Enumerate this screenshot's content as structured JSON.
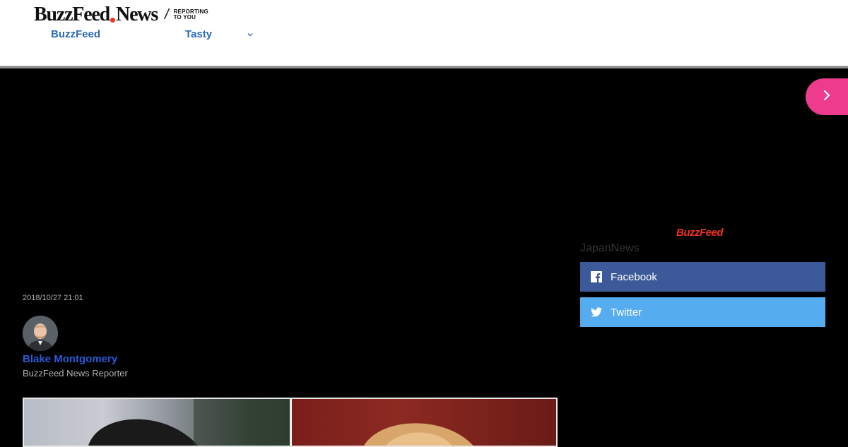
{
  "header": {
    "logo_buzz": "BuzzFeed",
    "logo_news": "News",
    "logo_slash": "/",
    "logo_tagline": "REPORTING TO YOU",
    "nav": [
      {
        "label": "BuzzFeed"
      },
      {
        "label": "Tasty"
      }
    ]
  },
  "sidebar": {
    "brand": "BuzzFeed",
    "section": "JapanNews",
    "share": [
      {
        "label": "Facebook",
        "icon": "facebook-icon",
        "color": "#3c5a99"
      },
      {
        "label": "Twitter",
        "icon": "twitter-icon",
        "color": "#55acee"
      }
    ]
  },
  "article": {
    "timestamp": "2018/10/27 21:01",
    "author": {
      "name": "Blake Montgomery",
      "role": "BuzzFeed News Reporter"
    }
  },
  "colors": {
    "accent_pink": "#ee3b8e",
    "brand_red": "#e32",
    "link_blue": "#2a6ab8"
  }
}
